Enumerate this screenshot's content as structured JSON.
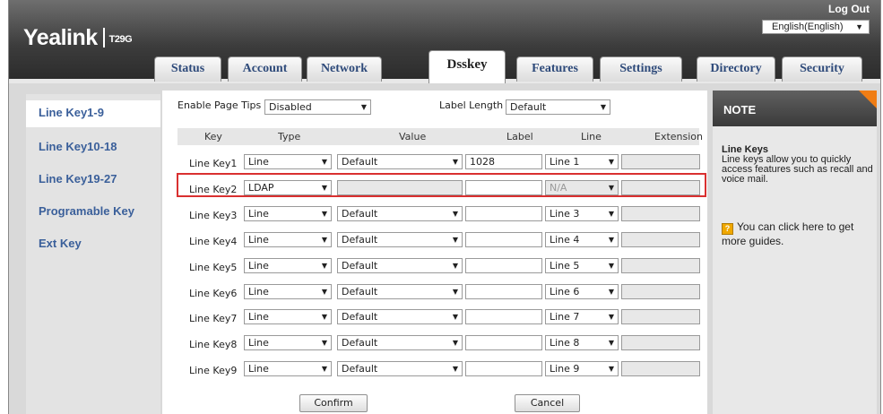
{
  "header": {
    "logo_brand": "Yealink",
    "logo_model": "T29G",
    "logout": "Log Out",
    "language": "English(English)"
  },
  "tabs": [
    {
      "label": "Status"
    },
    {
      "label": "Account"
    },
    {
      "label": "Network"
    },
    {
      "label": "Dsskey"
    },
    {
      "label": "Features"
    },
    {
      "label": "Settings"
    },
    {
      "label": "Directory"
    },
    {
      "label": "Security"
    }
  ],
  "active_tab": "Dsskey",
  "sidebar": {
    "items": [
      {
        "label": "Line Key1-9"
      },
      {
        "label": "Line Key10-18"
      },
      {
        "label": "Line Key19-27"
      },
      {
        "label": "Programable Key"
      },
      {
        "label": "Ext Key"
      }
    ]
  },
  "settings": {
    "page_tips_label": "Enable Page Tips",
    "page_tips_value": "Disabled",
    "label_length_label": "Label Length",
    "label_length_value": "Default"
  },
  "columns": {
    "key": "Key",
    "type": "Type",
    "value": "Value",
    "label": "Label",
    "line": "Line",
    "extension": "Extension"
  },
  "rows": [
    {
      "key": "Line Key1",
      "type": "Line",
      "value": "Default",
      "label": "1028",
      "line": "Line 1"
    },
    {
      "key": "Line Key2",
      "type": "LDAP",
      "value": "",
      "label": "",
      "line": "N/A"
    },
    {
      "key": "Line Key3",
      "type": "Line",
      "value": "Default",
      "label": "",
      "line": "Line 3"
    },
    {
      "key": "Line Key4",
      "type": "Line",
      "value": "Default",
      "label": "",
      "line": "Line 4"
    },
    {
      "key": "Line Key5",
      "type": "Line",
      "value": "Default",
      "label": "",
      "line": "Line 5"
    },
    {
      "key": "Line Key6",
      "type": "Line",
      "value": "Default",
      "label": "",
      "line": "Line 6"
    },
    {
      "key": "Line Key7",
      "type": "Line",
      "value": "Default",
      "label": "",
      "line": "Line 7"
    },
    {
      "key": "Line Key8",
      "type": "Line",
      "value": "Default",
      "label": "",
      "line": "Line 8"
    },
    {
      "key": "Line Key9",
      "type": "Line",
      "value": "Default",
      "label": "",
      "line": "Line 9"
    }
  ],
  "highlight_color": "#d93030",
  "buttons": {
    "confirm": "Confirm",
    "cancel": "Cancel"
  },
  "note": {
    "header": "NOTE",
    "title": "Line Keys",
    "text": "Line keys allow you to quickly access features such as recall and voice mail.",
    "help_icon": "?",
    "guide": "You can click here to get more guides."
  },
  "colors": {
    "accent_orange": "#f07d14",
    "link_blue": "#3a5f9a"
  }
}
